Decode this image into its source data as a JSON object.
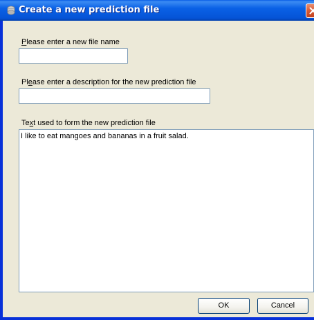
{
  "window": {
    "title": "Create a new prediction file"
  },
  "fields": {
    "file_name": {
      "label_mnemonic": "P",
      "label_rest": "lease enter a new file name",
      "value": ""
    },
    "description": {
      "label_before": "Pl",
      "label_mnemonic": "e",
      "label_rest": "ase enter a description for the new prediction file",
      "value": ""
    },
    "source_text": {
      "label_before": "Te",
      "label_mnemonic": "x",
      "label_rest": "t used to form the new prediction file",
      "value": "I like to eat mangoes and bananas in a fruit salad."
    }
  },
  "buttons": {
    "ok": "OK",
    "cancel": "Cancel"
  },
  "colors": {
    "titlebar": "#0a61e6",
    "dialog_bg": "#ece9d8",
    "close_button": "#d95a34",
    "input_border": "#7f9db9"
  },
  "icons": {
    "title": "app-icon",
    "close": "close-icon"
  }
}
